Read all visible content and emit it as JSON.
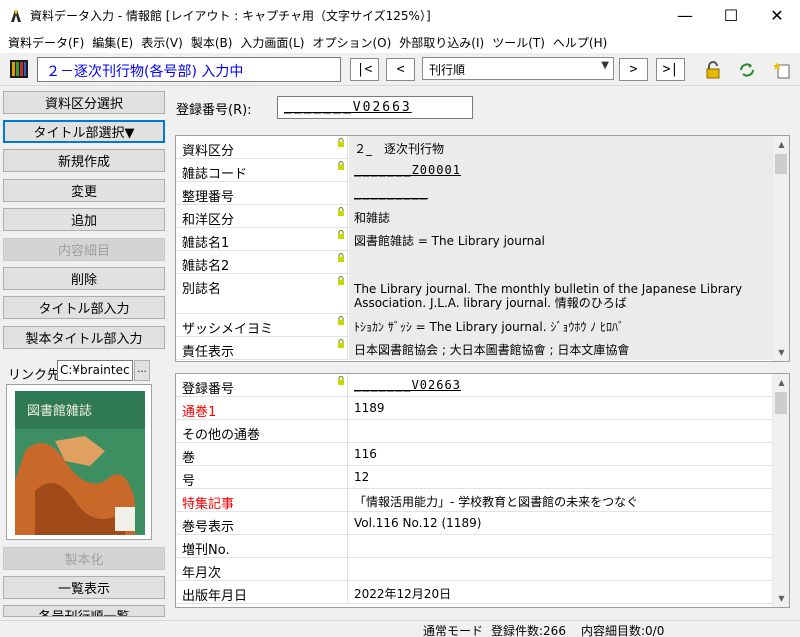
{
  "window": {
    "title": "資料データ入力 - 情報館 [レイアウト : キャプチャ用（文字サイズ125%）]",
    "minimize": "—",
    "maximize": "☐",
    "close": "✕"
  },
  "menu": [
    "資料データ(F)",
    "編集(E)",
    "表示(V)",
    "製本(B)",
    "入力画面(L)",
    "オプション(O)",
    "外部取り込み(I)",
    "ツール(T)",
    "ヘルプ(H)"
  ],
  "toolbar": {
    "mode": "２－逐次刊行物(各号部) 入力中",
    "first": "|<",
    "prev": "<",
    "order": "刊行順",
    "next": ">",
    "last": ">|"
  },
  "left_buttons": {
    "shiryo_kubun": "資料区分選択",
    "title_select": "タイトル部選択▼",
    "new": "新規作成",
    "change": "変更",
    "add": "追加",
    "detail": "内容細目",
    "delete": "削除",
    "title_input": "タイトル部入力",
    "binding_title_input": "製本タイトル部入力",
    "binding": "製本化",
    "list": "一覧表示",
    "partial": "各号刊行順一覧"
  },
  "link": {
    "label": "リンク先",
    "value": "C:¥braintec",
    "browse": "..."
  },
  "cover": {
    "title": "図書館雑誌"
  },
  "reg": {
    "label": "登録番号(R):",
    "value": "_______V02663"
  },
  "upper_rows": [
    {
      "label": "資料区分",
      "value": "２_　逐次刊行物"
    },
    {
      "label": "雑誌コード",
      "value": "_______Z00001"
    },
    {
      "label": "整理番号",
      "value": "_________"
    },
    {
      "label": "和洋区分",
      "value": "和雑誌"
    },
    {
      "label": "雑誌名1",
      "value": "図書館雑誌 = The Library journal"
    },
    {
      "label": "雑誌名2",
      "value": ""
    },
    {
      "label": "別誌名",
      "value": "The Library journal. The monthly bulletin of the Japanese Library",
      "value2": "Association. J.L.A. library journal. 情報のひろば"
    },
    {
      "label": "ザッシメイヨミ",
      "value": "ﾄｼｮｶﾝ ｻﾞｯｼ = The Library journal. ｼﾞｮｳﾎｳ ﾉ ﾋﾛﾊﾞ"
    },
    {
      "label": "責任表示",
      "value": "日本図書館協会 ; 大日本圖書館協會 ; 日本文庫協會"
    }
  ],
  "lower_rows": [
    {
      "label": "登録番号",
      "value": "_______V02663"
    },
    {
      "label": "通巻1",
      "value": "1189"
    },
    {
      "label": "その他の通巻",
      "value": ""
    },
    {
      "label": "巻",
      "value": "116"
    },
    {
      "label": "号",
      "value": "12"
    },
    {
      "label": "特集記事",
      "value": "「情報活用能力」- 学校教育と図書館の未来をつなぐ"
    },
    {
      "label": "巻号表示",
      "value": "Vol.116 No.12 (1189)"
    },
    {
      "label": "増刊No.",
      "value": ""
    },
    {
      "label": "年月次",
      "value": ""
    },
    {
      "label": "出版年月日",
      "value": "2022年12月20日"
    }
  ],
  "status": {
    "mode": "通常モード",
    "count": "登録件数:266",
    "detail_count": "内容細目数:0/0"
  },
  "colors": {
    "mode_text": "#0000ff",
    "required_label": "#ff0000"
  }
}
